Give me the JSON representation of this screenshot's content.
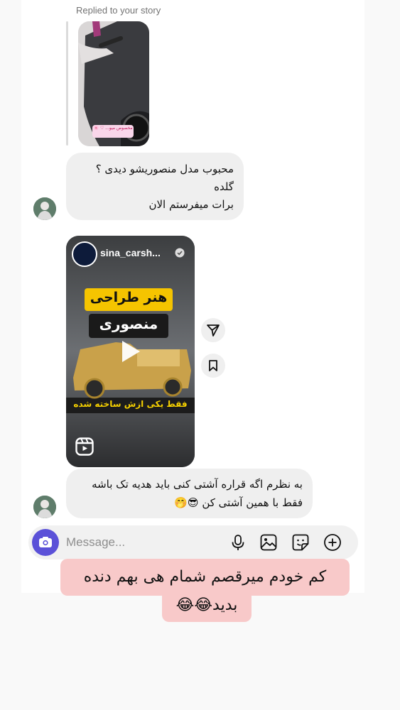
{
  "thread": {
    "replied_label": "Replied to your story",
    "story_sticker": "مخصوص میو... ♡ 🌸",
    "message1": {
      "lines": [
        "محبوب مدل منصوریشو دیدی ؟",
        "گلده",
        "برات میفرستم الان"
      ]
    },
    "reel": {
      "username": "sina_carsh...",
      "headline1": "هنر طراحی",
      "headline2": "منصوری",
      "subtitle": "فقط یکی ازش ساخته شده"
    },
    "message2": {
      "line1": "به نظرم اگه قراره آشتی کنی باید هدیه تک باشه",
      "line2": "فقط با همین آشتی کن 😎🤭"
    }
  },
  "composer": {
    "placeholder": "Message..."
  },
  "caption": {
    "line1": "کم خودم میرقصم شمام هی بهم دنده",
    "line2": "بدید😂😂"
  },
  "icons": [
    "camera-icon",
    "microphone-icon",
    "gallery-icon",
    "sticker-icon",
    "plus-icon",
    "share-icon",
    "bookmark-icon",
    "play-icon",
    "reels-icon",
    "verified-icon"
  ],
  "colors": {
    "bubble": "#efefef",
    "camera_button": "#5b51d8",
    "caption_bg": "#f8c9c9",
    "reel_subtitle": "#f5d000"
  }
}
